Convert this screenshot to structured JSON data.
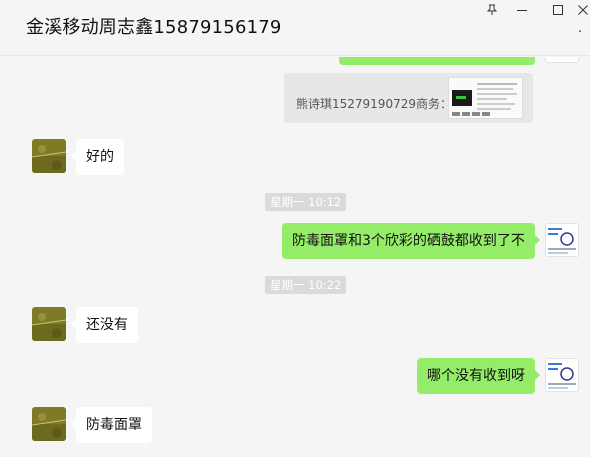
{
  "window": {
    "title": "金溪移动周志鑫15879156179",
    "more_dots": "·"
  },
  "chat": {
    "quote": {
      "text": "熊诗琪15279190729商务："
    },
    "messages": [
      {
        "side": "left",
        "text": "好的"
      },
      {
        "type": "time",
        "text": "星期一 10:12"
      },
      {
        "side": "right",
        "text": "防毒面罩和3个欣彩的硒鼓都收到了不"
      },
      {
        "type": "time",
        "text": "星期一 10:22"
      },
      {
        "side": "left",
        "text": "还没有"
      },
      {
        "side": "right",
        "text": "哪个没有收到呀"
      },
      {
        "side": "left",
        "text": "防毒面罩"
      }
    ]
  },
  "colors": {
    "background": "#f5f5f5",
    "bubble_self": "#95ec69",
    "bubble_other": "#ffffff",
    "timestamp_bg": "#dadada"
  },
  "icons": [
    "pin-icon",
    "minimize-icon",
    "maximize-icon",
    "close-icon",
    "more-icon"
  ]
}
